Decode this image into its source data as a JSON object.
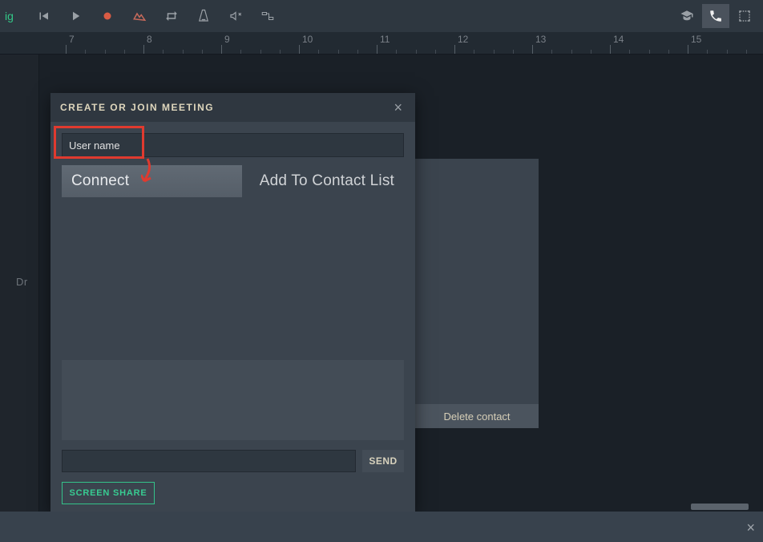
{
  "toolbar": {
    "word_fragment": "ig"
  },
  "ruler": {
    "start": 7,
    "end": 17,
    "major_spacing_px": 97
  },
  "canvas": {
    "drop_hint": "Dr"
  },
  "side_panel": {
    "delete_label": "Delete contact"
  },
  "modal": {
    "title": "CREATE OR JOIN MEETING",
    "username_value": "User name",
    "connect_label": "Connect",
    "add_contact_label": "Add To Contact List",
    "send_label": "SEND",
    "screen_share_label": "SCREEN SHARE"
  }
}
